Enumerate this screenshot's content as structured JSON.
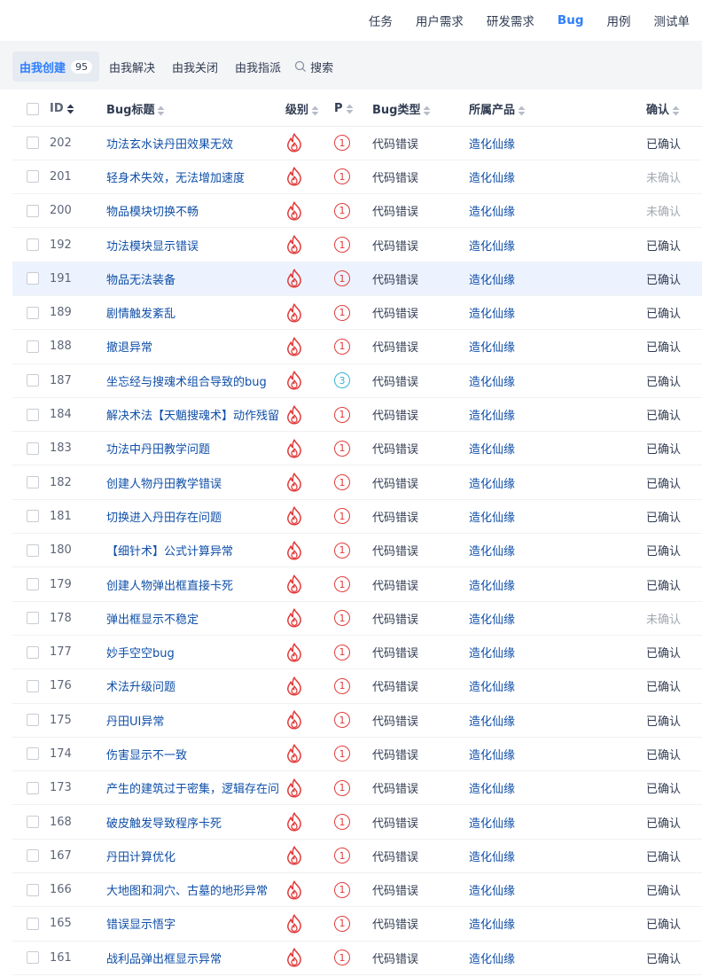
{
  "topnav": {
    "items": [
      {
        "label": "任务",
        "active": false
      },
      {
        "label": "用户需求",
        "active": false
      },
      {
        "label": "研发需求",
        "active": false
      },
      {
        "label": "Bug",
        "active": true
      },
      {
        "label": "用例",
        "active": false
      },
      {
        "label": "测试单",
        "active": false
      }
    ]
  },
  "filters": {
    "created_label": "由我创建",
    "created_count": "95",
    "resolved_label": "由我解决",
    "closed_label": "由我关闭",
    "assigned_label": "由我指派",
    "search_label": "搜索"
  },
  "table": {
    "headers": {
      "id": "ID",
      "title": "Bug标题",
      "severity": "级别",
      "priority": "P",
      "type": "Bug类型",
      "product": "所属产品",
      "confirmed": "确认"
    },
    "colors": {
      "link": "#0f4fa8",
      "severity": "#e23a3a",
      "priority_high": "#e23a3a",
      "priority_low": "#36b4d6",
      "accent": "#2e7fff"
    },
    "rows": [
      {
        "id": "202",
        "title": "功法玄水诀丹田效果无效",
        "priority": "1",
        "type": "代码错误",
        "product": "造化仙缘",
        "confirmed": "已确认"
      },
      {
        "id": "201",
        "title": "轻身术失效，无法增加速度",
        "priority": "1",
        "type": "代码错误",
        "product": "造化仙缘",
        "confirmed": "未确认"
      },
      {
        "id": "200",
        "title": "物品模块切换不畅",
        "priority": "1",
        "type": "代码错误",
        "product": "造化仙缘",
        "confirmed": "未确认"
      },
      {
        "id": "192",
        "title": "功法模块显示错误",
        "priority": "1",
        "type": "代码错误",
        "product": "造化仙缘",
        "confirmed": "已确认"
      },
      {
        "id": "191",
        "title": "物品无法装备",
        "priority": "1",
        "type": "代码错误",
        "product": "造化仙缘",
        "confirmed": "已确认"
      },
      {
        "id": "189",
        "title": "剧情触发紊乱",
        "priority": "1",
        "type": "代码错误",
        "product": "造化仙缘",
        "confirmed": "已确认"
      },
      {
        "id": "188",
        "title": "撤退异常",
        "priority": "1",
        "type": "代码错误",
        "product": "造化仙缘",
        "confirmed": "已确认"
      },
      {
        "id": "187",
        "title": "坐忘经与搜魂术组合导致的bug",
        "priority": "3",
        "type": "代码错误",
        "product": "造化仙缘",
        "confirmed": "已确认"
      },
      {
        "id": "184",
        "title": "解决术法【天魈搜魂术】动作残留",
        "priority": "1",
        "type": "代码错误",
        "product": "造化仙缘",
        "confirmed": "已确认"
      },
      {
        "id": "183",
        "title": "功法中丹田教学问题",
        "priority": "1",
        "type": "代码错误",
        "product": "造化仙缘",
        "confirmed": "已确认"
      },
      {
        "id": "182",
        "title": "创建人物丹田教学错误",
        "priority": "1",
        "type": "代码错误",
        "product": "造化仙缘",
        "confirmed": "已确认"
      },
      {
        "id": "181",
        "title": "切换进入丹田存在问题",
        "priority": "1",
        "type": "代码错误",
        "product": "造化仙缘",
        "confirmed": "已确认"
      },
      {
        "id": "180",
        "title": "【细针术】公式计算异常",
        "priority": "1",
        "type": "代码错误",
        "product": "造化仙缘",
        "confirmed": "已确认"
      },
      {
        "id": "179",
        "title": "创建人物弹出框直接卡死",
        "priority": "1",
        "type": "代码错误",
        "product": "造化仙缘",
        "confirmed": "已确认"
      },
      {
        "id": "178",
        "title": "弹出框显示不稳定",
        "priority": "1",
        "type": "代码错误",
        "product": "造化仙缘",
        "confirmed": "未确认"
      },
      {
        "id": "177",
        "title": "妙手空空bug",
        "priority": "1",
        "type": "代码错误",
        "product": "造化仙缘",
        "confirmed": "已确认"
      },
      {
        "id": "176",
        "title": "术法升级问题",
        "priority": "1",
        "type": "代码错误",
        "product": "造化仙缘",
        "confirmed": "已确认"
      },
      {
        "id": "175",
        "title": "丹田UI异常",
        "priority": "1",
        "type": "代码错误",
        "product": "造化仙缘",
        "confirmed": "已确认"
      },
      {
        "id": "174",
        "title": "伤害显示不一致",
        "priority": "1",
        "type": "代码错误",
        "product": "造化仙缘",
        "confirmed": "已确认"
      },
      {
        "id": "173",
        "title": "产生的建筑过于密集，逻辑存在问题",
        "priority": "1",
        "type": "代码错误",
        "product": "造化仙缘",
        "confirmed": "已确认"
      },
      {
        "id": "168",
        "title": "破皮触发导致程序卡死",
        "priority": "1",
        "type": "代码错误",
        "product": "造化仙缘",
        "confirmed": "已确认"
      },
      {
        "id": "167",
        "title": "丹田计算优化",
        "priority": "1",
        "type": "代码错误",
        "product": "造化仙缘",
        "confirmed": "已确认"
      },
      {
        "id": "166",
        "title": "大地图和洞穴、古墓的地形异常",
        "priority": "1",
        "type": "代码错误",
        "product": "造化仙缘",
        "confirmed": "已确认"
      },
      {
        "id": "165",
        "title": "错误显示悟字",
        "priority": "1",
        "type": "代码错误",
        "product": "造化仙缘",
        "confirmed": "已确认"
      },
      {
        "id": "161",
        "title": "战利品弹出框显示异常",
        "priority": "1",
        "type": "代码错误",
        "product": "造化仙缘",
        "confirmed": "已确认"
      }
    ]
  }
}
